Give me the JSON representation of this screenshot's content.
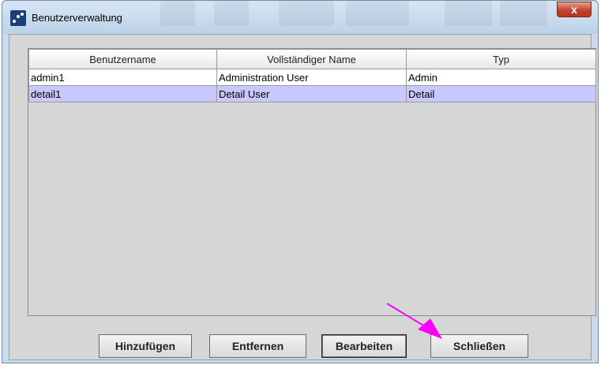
{
  "window": {
    "title": "Benutzerverwaltung",
    "close_symbol": "x"
  },
  "table": {
    "columns": [
      "Benutzername",
      "Vollständiger Name",
      "Typ"
    ],
    "rows": [
      {
        "username": "admin1",
        "fullname": "Administration User",
        "type": "Admin",
        "selected": false
      },
      {
        "username": "detail1",
        "fullname": "Detail User",
        "type": "Detail",
        "selected": true
      }
    ]
  },
  "buttons": {
    "add": "Hinzufügen",
    "remove": "Entfernen",
    "edit": "Bearbeiten",
    "close": "Schließen"
  },
  "colors": {
    "selected_row": "#c9c7ff",
    "annotation_arrow": "#ff00ff"
  }
}
